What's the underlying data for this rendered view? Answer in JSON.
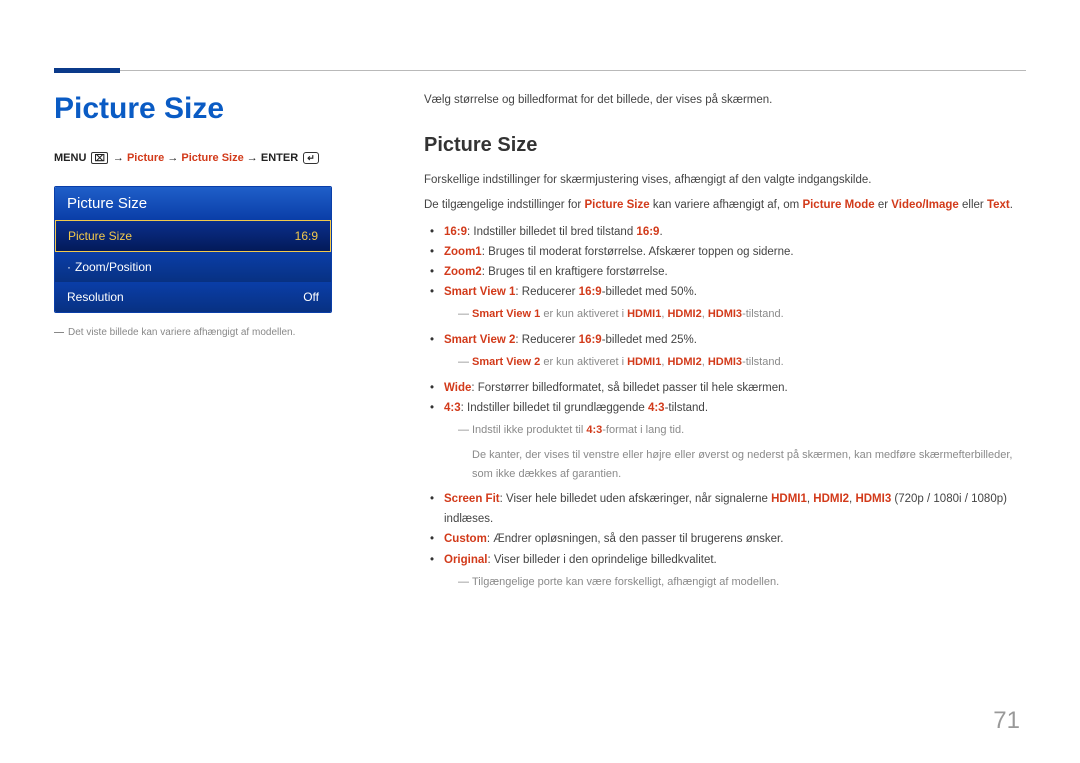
{
  "page_number": "71",
  "left": {
    "h1": "Picture Size",
    "path": {
      "menu": "MENU",
      "menu_icon": "⌧",
      "arrow": " → ",
      "p1": "Picture",
      "p2": "Picture Size",
      "enter": "ENTER",
      "enter_icon": "↵"
    },
    "osd": {
      "header": "Picture Size",
      "rows": [
        {
          "label": "Picture Size",
          "value": "16:9",
          "hl": true,
          "dot": false
        },
        {
          "label": "Zoom/Position",
          "value": "",
          "hl": false,
          "dot": true
        },
        {
          "label": "Resolution",
          "value": "Off",
          "hl": false,
          "dot": false
        }
      ]
    },
    "footnote": "Det viste billede kan variere afhængigt af modellen."
  },
  "right": {
    "intro": "Vælg størrelse og billedformat for det billede, der vises på skærmen.",
    "h2": "Picture Size",
    "p1": "Forskellige indstillinger for skærmjustering vises, afhængigt af den valgte indgangskilde.",
    "p2_a": "De tilgængelige indstillinger for ",
    "p2_b": "Picture Size",
    "p2_c": " kan variere afhængigt af, om ",
    "p2_d": "Picture Mode",
    "p2_e": " er ",
    "p2_f": "Video/Image",
    "p2_g": " eller ",
    "p2_h": "Text",
    "p2_i": ".",
    "bullets": {
      "b1_a": "16:9",
      "b1_b": ": Indstiller billedet til bred tilstand ",
      "b1_c": "16:9",
      "b1_d": ".",
      "b2_a": "Zoom1",
      "b2_b": ": Bruges til moderat forstørrelse. Afskærer toppen og siderne.",
      "b3_a": "Zoom2",
      "b3_b": ": Bruges til en kraftigere forstørrelse.",
      "b4_a": "Smart View 1",
      "b4_b": ": Reducerer ",
      "b4_c": "16:9",
      "b4_d": "-billedet med 50%.",
      "b4n_a": "Smart View 1",
      "b4n_b": " er kun aktiveret i ",
      "b4n_c": "HDMI1",
      "b4n_d": ", ",
      "b4n_e": "HDMI2",
      "b4n_f": ", ",
      "b4n_g": "HDMI3",
      "b4n_h": "-tilstand.",
      "b5_a": "Smart View 2",
      "b5_b": ": Reducerer ",
      "b5_c": "16:9",
      "b5_d": "-billedet med 25%.",
      "b5n_a": "Smart View 2",
      "b5n_b": " er kun aktiveret i ",
      "b5n_c": "HDMI1",
      "b5n_d": ", ",
      "b5n_e": "HDMI2",
      "b5n_f": ", ",
      "b5n_g": "HDMI3",
      "b5n_h": "-tilstand.",
      "b6_a": "Wide",
      "b6_b": ": Forstørrer billedformatet, så billedet passer til hele skærmen.",
      "b7_a": "4:3",
      "b7_b": ": Indstiller billedet til grundlæggende ",
      "b7_c": "4:3",
      "b7_d": "-tilstand.",
      "b7n1_a": "Indstil ikke produktet til ",
      "b7n1_b": "4:3",
      "b7n1_c": "-format i lang tid.",
      "b7n2": "De kanter, der vises til venstre eller højre eller øverst og nederst på skærmen, kan medføre skærmefterbilleder, som ikke dækkes af garantien.",
      "b8_a": "Screen Fit",
      "b8_b": ": Viser hele billedet uden afskæringer, når signalerne ",
      "b8_c": "HDMI1",
      "b8_d": ", ",
      "b8_e": "HDMI2",
      "b8_f": ", ",
      "b8_g": "HDMI3",
      "b8_h": " (720p / 1080i / 1080p) indlæses.",
      "b9_a": "Custom",
      "b9_b": ": Ændrer opløsningen, så den passer til brugerens ønsker.",
      "b10_a": "Original",
      "b10_b": ": Viser billeder i den oprindelige billedkvalitet.",
      "tail": "Tilgængelige porte kan være forskelligt, afhængigt af modellen."
    }
  }
}
